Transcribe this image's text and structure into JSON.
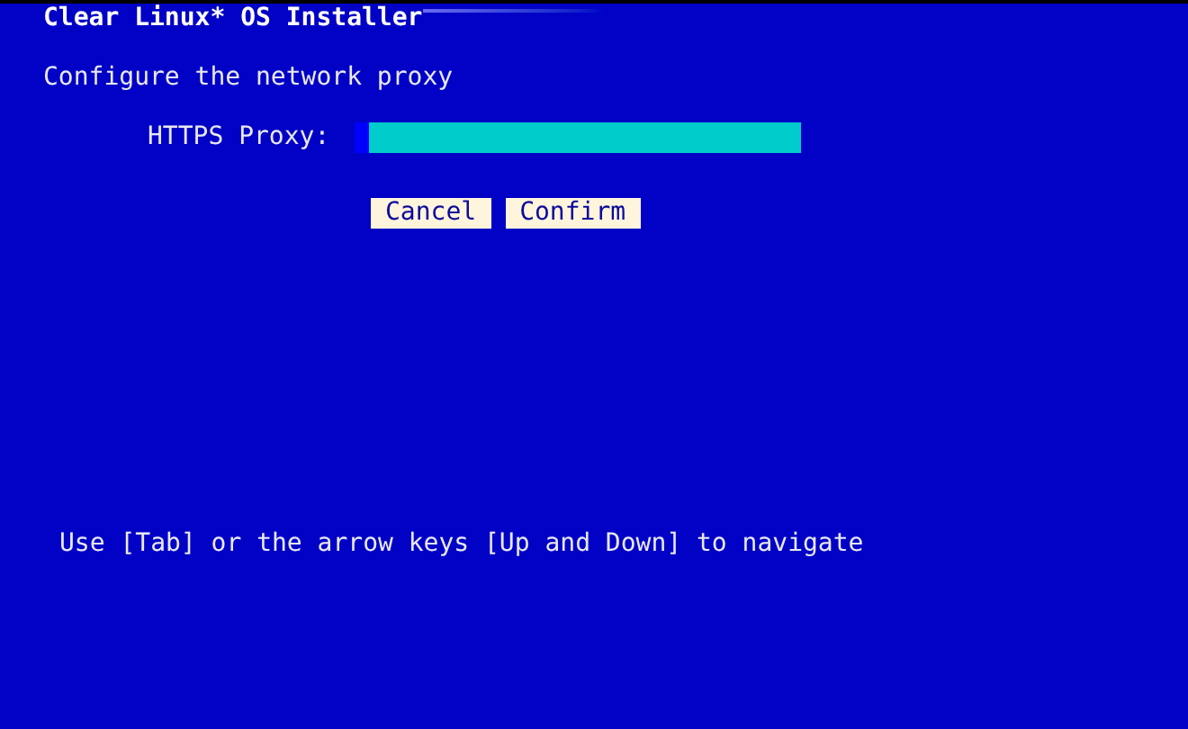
{
  "window": {
    "title": "Clear Linux* OS Installer"
  },
  "heading": "Configure the network proxy",
  "field": {
    "label": "HTTPS Proxy:",
    "focused": true
  },
  "buttons": [
    {
      "label": "Cancel"
    },
    {
      "label": "Confirm"
    }
  ],
  "hint": "Use [Tab] or the arrow keys [Up and Down] to navigate"
}
